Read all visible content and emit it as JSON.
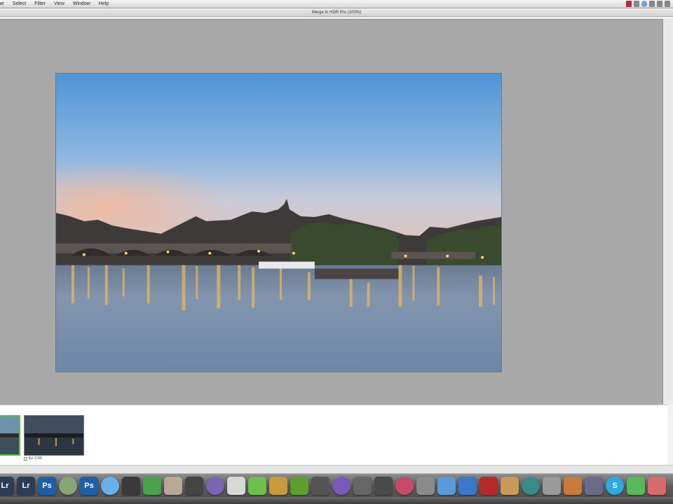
{
  "menubar": {
    "items": [
      "ae",
      "Select",
      "Filter",
      "View",
      "Window",
      "Help"
    ]
  },
  "window": {
    "title": "Merge to HDR Pro (100%)"
  },
  "filmstrip": {
    "thumb2_label": "Ev -2.00"
  },
  "dock": {
    "apps": [
      {
        "name": "lightroom",
        "label": "Lr",
        "color": "#2b3d55"
      },
      {
        "name": "lightroom-2",
        "label": "Lr",
        "color": "#2b3d55"
      },
      {
        "name": "photoshop",
        "label": "Ps",
        "color": "#1d5fa8"
      },
      {
        "name": "globe-app",
        "label": "",
        "color": "#8aa47a"
      },
      {
        "name": "photoshop-2",
        "label": "Ps",
        "color": "#1d5fa8"
      },
      {
        "name": "ichat",
        "label": "",
        "color": "#6ab0e8"
      },
      {
        "name": "clapper",
        "label": "",
        "color": "#3a3a3a"
      },
      {
        "name": "numbers",
        "label": "",
        "color": "#4aa24a"
      },
      {
        "name": "photo-app",
        "label": "",
        "color": "#b7a898"
      },
      {
        "name": "clapper-2",
        "label": "",
        "color": "#444"
      },
      {
        "name": "dvd",
        "label": "",
        "color": "#7a64b4"
      },
      {
        "name": "upload",
        "label": "",
        "color": "#d8d8d8"
      },
      {
        "name": "green-app",
        "label": "",
        "color": "#6cbf4a"
      },
      {
        "name": "orange-app",
        "label": "",
        "color": "#c89a3a"
      },
      {
        "name": "evernote",
        "label": "",
        "color": "#5aa02a"
      },
      {
        "name": "clapper-3",
        "label": "",
        "color": "#555"
      },
      {
        "name": "itunes",
        "label": "",
        "color": "#7a5ab8"
      },
      {
        "name": "film",
        "label": "",
        "color": "#666"
      },
      {
        "name": "clapper-4",
        "label": "",
        "color": "#4a4a4a"
      },
      {
        "name": "color-app",
        "label": "",
        "color": "#c84a6a"
      },
      {
        "name": "brush",
        "label": "",
        "color": "#8a8a8a"
      },
      {
        "name": "finder",
        "label": "",
        "color": "#5a9ad8"
      },
      {
        "name": "google-earth",
        "label": "",
        "color": "#3a78c8"
      },
      {
        "name": "red-book",
        "label": "",
        "color": "#b82a2a"
      },
      {
        "name": "iphoto",
        "label": "",
        "color": "#c89a5a"
      },
      {
        "name": "time-machine",
        "label": "",
        "color": "#3a8a8a"
      },
      {
        "name": "screenshot",
        "label": "",
        "color": "#9a9a9a"
      },
      {
        "name": "keynote",
        "label": "",
        "color": "#c87a3a"
      },
      {
        "name": "pen-tool",
        "label": "",
        "color": "#6a6a8a"
      },
      {
        "name": "skype",
        "label": "S",
        "color": "#2aa8e0"
      },
      {
        "name": "activity",
        "label": "",
        "color": "#5ab85a"
      },
      {
        "name": "preview-app",
        "label": "",
        "color": "#d86a6a"
      }
    ]
  }
}
